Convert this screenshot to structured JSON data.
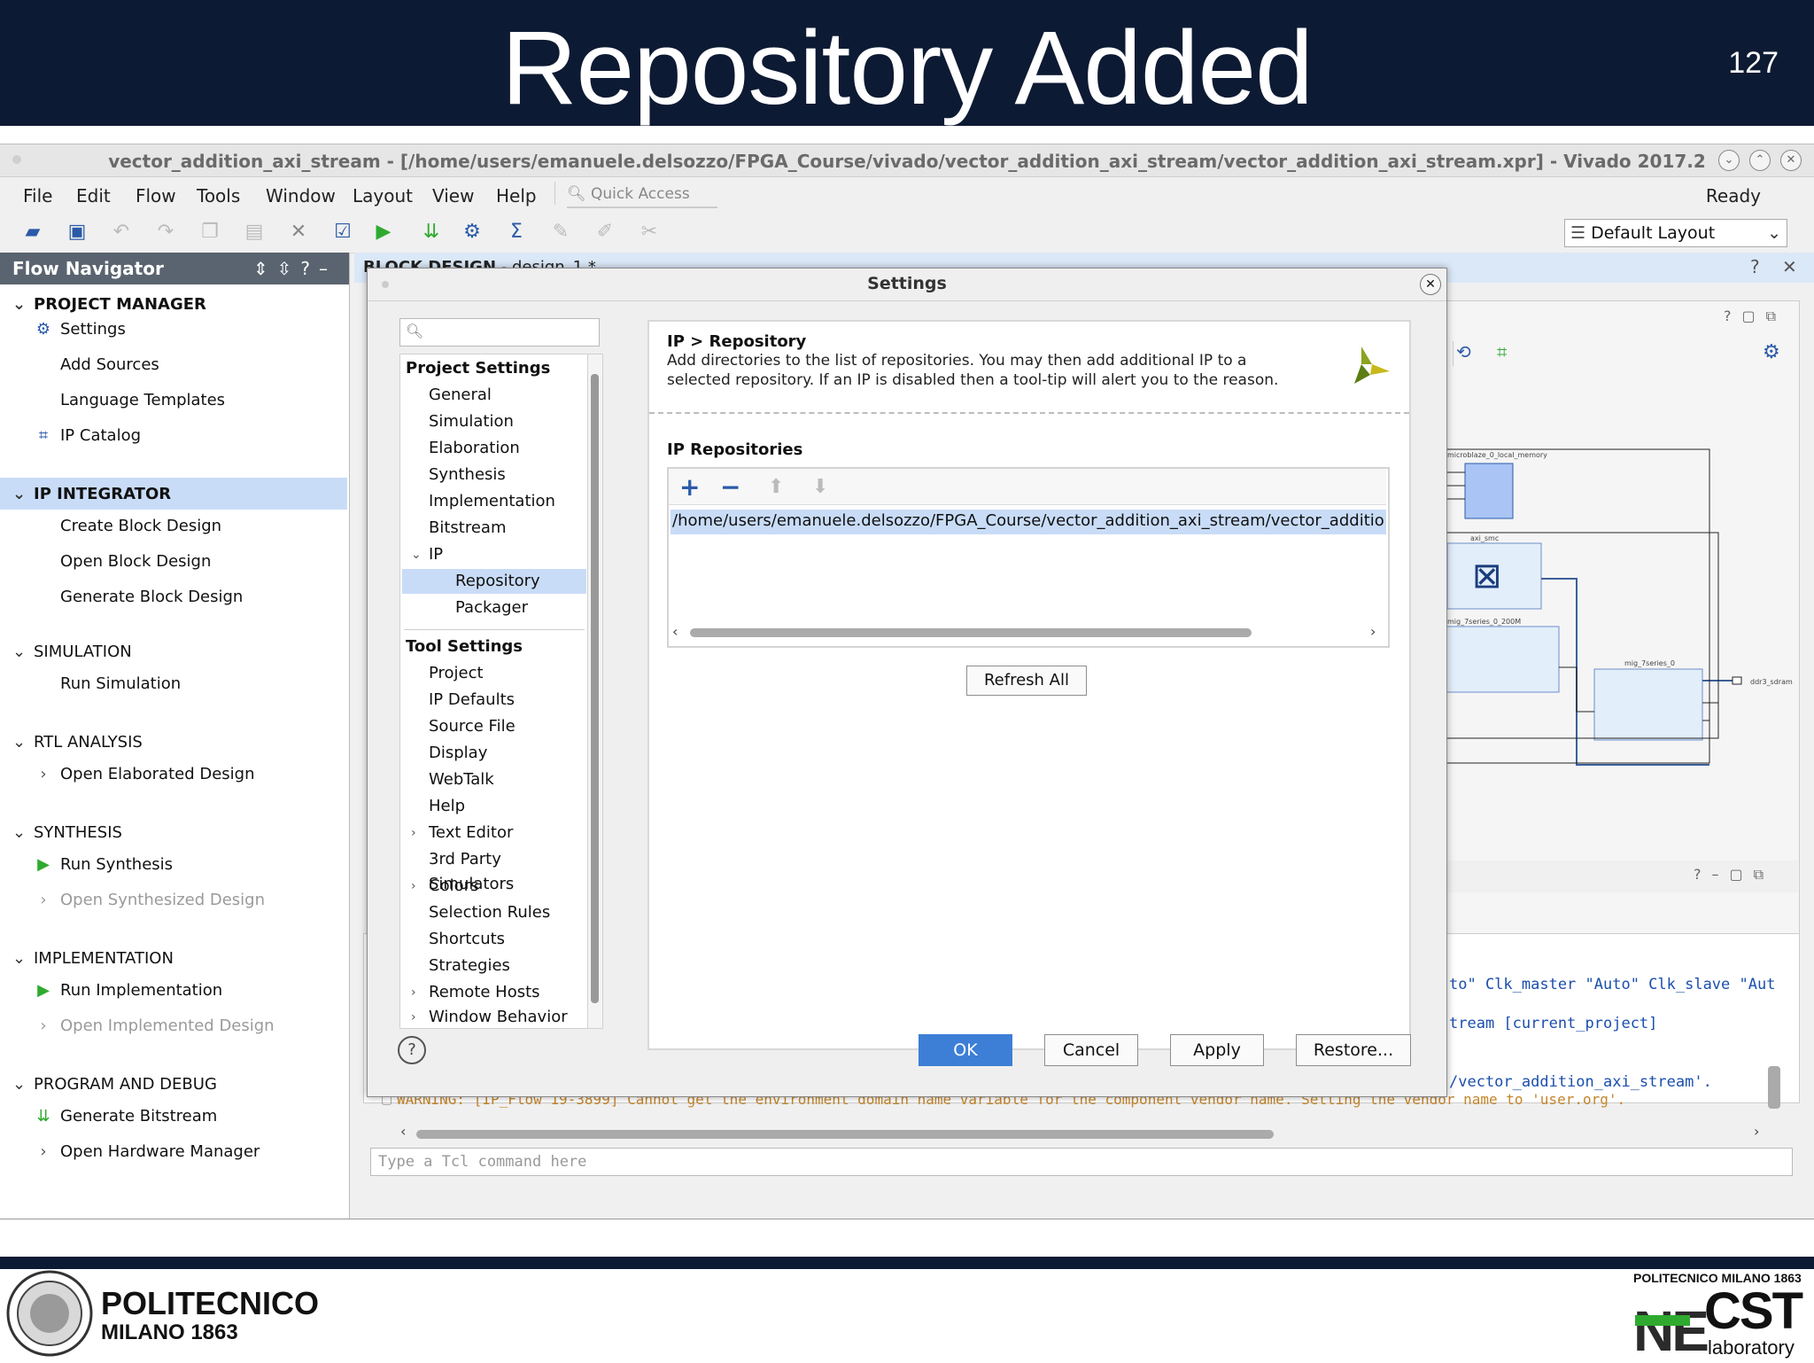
{
  "slide": {
    "title": "Repository Added",
    "number": "127"
  },
  "window": {
    "title": "vector_addition_axi_stream - [/home/users/emanuele.delsozzo/FPGA_Course/vivado/vector_addition_axi_stream/vector_addition_axi_stream.xpr] - Vivado 2017.2",
    "menu": [
      "File",
      "Edit",
      "Flow",
      "Tools",
      "Window",
      "Layout",
      "View",
      "Help"
    ],
    "quick_access": "Quick Access",
    "status": "Ready",
    "layout_select": "Default Layout"
  },
  "flow_navigator": {
    "title": "Flow Navigator",
    "sections": [
      {
        "label": "PROJECT MANAGER",
        "items": [
          "Settings",
          "Add Sources",
          "Language Templates",
          "IP Catalog"
        ]
      },
      {
        "label": "IP INTEGRATOR",
        "items": [
          "Create Block Design",
          "Open Block Design",
          "Generate Block Design"
        ]
      },
      {
        "label": "SIMULATION",
        "items": [
          "Run Simulation"
        ]
      },
      {
        "label": "RTL ANALYSIS",
        "items": [
          "Open Elaborated Design"
        ]
      },
      {
        "label": "SYNTHESIS",
        "items": [
          "Run Synthesis",
          "Open Synthesized Design"
        ]
      },
      {
        "label": "IMPLEMENTATION",
        "items": [
          "Run Implementation",
          "Open Implemented Design"
        ]
      },
      {
        "label": "PROGRAM AND DEBUG",
        "items": [
          "Generate Bitstream",
          "Open Hardware Manager"
        ]
      }
    ]
  },
  "block_design": {
    "title_bold": "BLOCK DESIGN",
    "title_rest": " - design_1 *",
    "diagram_labels": [
      "microblaze_0_local_memory",
      "axi_smc",
      "mig_7series_0_200M",
      "mig_7series_0",
      "ddr3_sdram"
    ]
  },
  "tcl": {
    "lines": [
      "to\" Clk_master \"Auto\" Clk_slave \"Aut",
      "tream [current_project]",
      "/vector_addition_axi_stream'."
    ],
    "warning": "WARNING: [IP_Flow 19-3899] Cannot get the environment domain name variable for the component vendor name. Setting the vendor name to 'user.org'.",
    "placeholder": "Type a Tcl command here"
  },
  "dialog": {
    "title": "Settings",
    "tree": {
      "project_header": "Project Settings",
      "project_items": [
        "General",
        "Simulation",
        "Elaboration",
        "Synthesis",
        "Implementation",
        "Bitstream",
        "IP"
      ],
      "ip_children": [
        "Repository",
        "Packager"
      ],
      "tool_header": "Tool Settings",
      "tool_items": [
        "Project",
        "IP Defaults",
        "Source File",
        "Display",
        "WebTalk",
        "Help",
        "Text Editor",
        "3rd Party Simulators",
        "Colors",
        "Selection Rules",
        "Shortcuts",
        "Strategies",
        "Remote Hosts",
        "Window Behavior"
      ]
    },
    "panel": {
      "heading": "IP > Repository",
      "description_1": "Add directories to the list of repositories. You may then add additional IP to a",
      "description_2": "selected repository. If an IP is disabled then a tool-tip will alert you to the reason.",
      "section": "IP Repositories",
      "repository": "/home/users/emanuele.delsozzo/FPGA_Course/vector_addition_axi_stream/vector_addition_a",
      "refresh": "Refresh All"
    },
    "buttons": {
      "ok": "OK",
      "cancel": "Cancel",
      "apply": "Apply",
      "restore": "Restore..."
    }
  },
  "footer": {
    "left_line1": "POLITECNICO",
    "left_line2": "MILANO 1863",
    "right_line1": "POLITECNICO MILANO 1863",
    "right_ne": "NE",
    "right_cst": "CST",
    "right_lab": "laboratory"
  },
  "colors": {
    "banner": "#0d1a33",
    "selection": "#c9dcf7",
    "ok_button": "#3d7fd6",
    "accent_green": "#2faa2f"
  }
}
